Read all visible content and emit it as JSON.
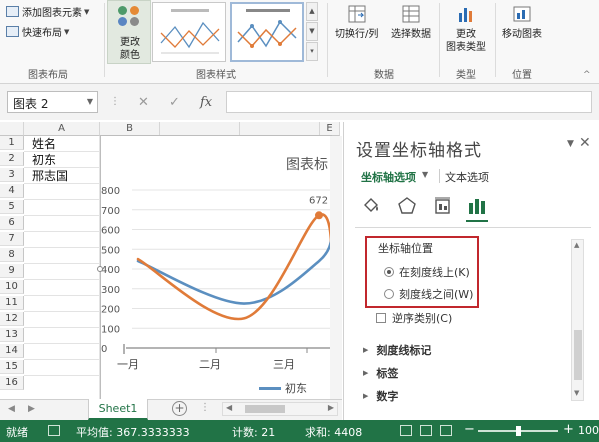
{
  "ribbon": {
    "add_chart_element": "添加图表元素",
    "quick_layout": "快速布局",
    "chart_layouts_group": "图表布局",
    "change_colors_line1": "更改",
    "change_colors_line2": "颜色",
    "chart_styles_group": "图表样式",
    "switch_row_col": "切换行/列",
    "select_data": "选择数据",
    "data_group": "数据",
    "change_type_line1": "更改",
    "change_type_line2": "图表类型",
    "type_group": "类型",
    "move_chart": "移动图表",
    "location_group": "位置"
  },
  "formula_bar": {
    "name_box": "图表 2",
    "fx": "fx",
    "formula": ""
  },
  "sheet": {
    "columns": [
      "A",
      "B",
      "C",
      "D",
      "E"
    ],
    "rows": [
      "1",
      "2",
      "3",
      "4",
      "5",
      "6",
      "7",
      "8",
      "9",
      "10",
      "11",
      "12",
      "13",
      "14",
      "15",
      "16"
    ],
    "cells": {
      "A1": "姓名",
      "A2": "初东",
      "A3": "邢志国",
      "partial_top_right": "二月"
    },
    "tab": "Sheet1"
  },
  "chart": {
    "title_partial": "图表标",
    "legend_partial": "初东",
    "point_label": "672"
  },
  "chart_data": {
    "type": "line",
    "categories": [
      "一月",
      "二月",
      "三月"
    ],
    "categories_partial": [
      "一月",
      "二月",
      "三月"
    ],
    "yticks": [
      "0",
      "100",
      "200",
      "300",
      "400",
      "500",
      "600",
      "700",
      "800"
    ],
    "ylim": [
      0,
      800
    ],
    "series": [
      {
        "name": "初东",
        "color": "#5b8fc0",
        "values": [
          440,
          225,
          440
        ]
      },
      {
        "color": "#e07b39",
        "values": [
          450,
          150,
          672
        ]
      }
    ],
    "data_labels": [
      "672"
    ]
  },
  "pane": {
    "title": "设置坐标轴格式",
    "tab_axis_options": "坐标轴选项",
    "tab_text_options": "文本选项",
    "axis_position_title": "坐标轴位置",
    "on_tick_marks": "在刻度线上(K)",
    "between_tick_marks": "刻度线之间(W)",
    "categories_reverse": "逆序类别(C)",
    "tick_marks": "刻度线标记",
    "labels": "标签",
    "number": "数字",
    "icons": [
      "fill-line-icon",
      "effects-icon",
      "size-properties-icon",
      "axis-options-icon"
    ]
  },
  "status": {
    "ready": "就绪",
    "average": "平均值: 367.3333333",
    "count": "计数: 21",
    "sum": "求和: 4408",
    "zoom": "100%",
    "minus": "−",
    "plus": "+"
  }
}
